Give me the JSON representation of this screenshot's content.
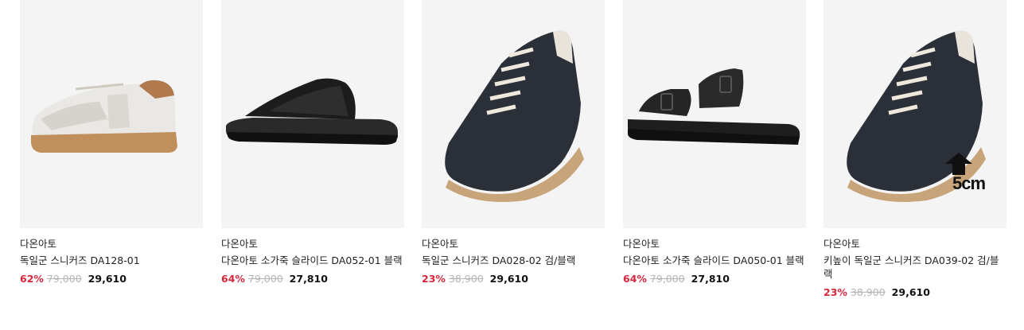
{
  "products": [
    {
      "brand": "다온아토",
      "name": "독일군 스니커즈 DA128-01",
      "discount": "62%",
      "original_price": "79,000",
      "sale_price": "29,610",
      "image_icon": "white-sneaker-icon"
    },
    {
      "brand": "다온아토",
      "name": "다온아토 소가죽 슬라이드 DA052-01 블랙",
      "discount": "64%",
      "original_price": "79,000",
      "sale_price": "27,810",
      "image_icon": "black-cross-slide-icon"
    },
    {
      "brand": "다온아토",
      "name": "독일군 스니커즈 DA028-02 검/블랙",
      "discount": "23%",
      "original_price": "38,900",
      "sale_price": "29,610",
      "image_icon": "black-sneaker-icon"
    },
    {
      "brand": "다온아토",
      "name": "다온아토 소가죽 슬라이드 DA050-01 블랙",
      "discount": "64%",
      "original_price": "79,000",
      "sale_price": "27,810",
      "image_icon": "black-buckle-slide-icon"
    },
    {
      "brand": "다온아토",
      "name": "키높이 독일군 스니커즈 DA039-02 검/블랙",
      "discount": "23%",
      "original_price": "38,900",
      "sale_price": "29,610",
      "image_icon": "black-sneaker-icon",
      "badge": "5cm"
    }
  ]
}
